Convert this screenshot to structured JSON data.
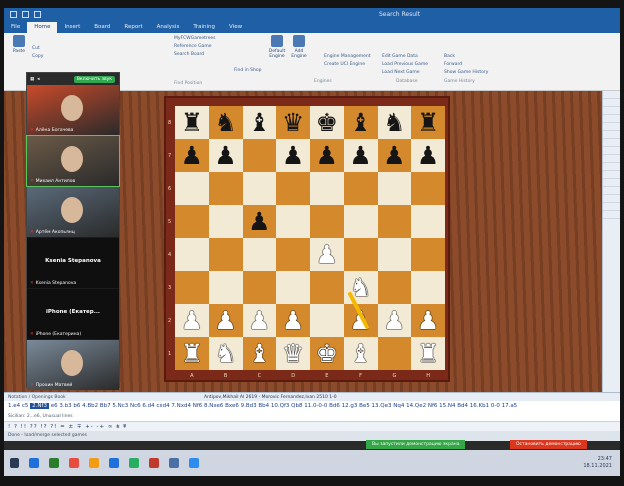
{
  "window": {
    "title": "Search Result"
  },
  "ribbon": {
    "tabs": [
      "File",
      "Home",
      "Insert",
      "Board",
      "Report",
      "Analysis",
      "Training",
      "View"
    ],
    "active_tab": "Home",
    "clipboard": {
      "paste": "Paste",
      "cut": "Cut",
      "copy": "Copy"
    },
    "find": {
      "label": "Find Position",
      "items": [
        "MyFCWGametrees",
        "Reference Game",
        "Search Board"
      ],
      "find_in_shop": "Find in Shop"
    },
    "engines": {
      "label": "Engines",
      "default_engine": "Default Engine",
      "add_engine": "Add Engine",
      "items": [
        "Engine Management",
        "Create UCI Engine"
      ]
    },
    "database": {
      "label": "Database",
      "items": [
        "Edit Game Data",
        "Load Previous Game",
        "Load Next Game"
      ]
    },
    "history": {
      "label": "Game History",
      "items": [
        "Back",
        "Forward",
        "Show Game History"
      ]
    }
  },
  "zoom": {
    "share_button": "Включить звук",
    "participants": [
      {
        "name": "Алёна Богачева",
        "video": true,
        "color": "#c94a2a"
      },
      {
        "name": "Михаил Антипов",
        "video": true,
        "color": "#6a5a48"
      },
      {
        "name": "Артём Акопьянц",
        "video": true,
        "color": "#5a6a7a"
      },
      {
        "name": "Ksenia Stepanova",
        "video": false,
        "color": "#000000"
      },
      {
        "name": "iPhone (Екатерина)",
        "display": "iPhone (Екатер...",
        "video": false,
        "color": "#000000"
      },
      {
        "name": "Прохин Матвей",
        "video": true,
        "color": "#7a8a9a"
      }
    ]
  },
  "board": {
    "rank_labels": [
      "8",
      "7",
      "6",
      "5",
      "4",
      "3",
      "2",
      "1"
    ],
    "file_labels": [
      "A",
      "B",
      "C",
      "D",
      "E",
      "F",
      "G",
      "H"
    ],
    "position": [
      [
        "br",
        "bn",
        "bb",
        "bq",
        "bk",
        "bb",
        "bn",
        "br"
      ],
      [
        "bp",
        "bp",
        "",
        "bp",
        "bp",
        "bp",
        "bp",
        "bp"
      ],
      [
        "",
        "",
        "",
        "",
        "",
        "",
        "",
        ""
      ],
      [
        "",
        "",
        "bp",
        "",
        "",
        "",
        "",
        ""
      ],
      [
        "",
        "",
        "",
        "",
        "wp",
        "",
        "",
        ""
      ],
      [
        "",
        "",
        "",
        "",
        "",
        "wn",
        "",
        ""
      ],
      [
        "wp",
        "wp",
        "wp",
        "wp",
        "",
        "wp",
        "wp",
        "wp"
      ],
      [
        "wr",
        "wn",
        "wb",
        "wq",
        "wk",
        "wb",
        "",
        "wr"
      ]
    ],
    "last_move": "Nf3"
  },
  "game_info": {
    "left": "Notation / Openings Book",
    "players": "Antipov,Mikhail Al 2619 - Morovic Fernandez,Ivan 2510 1-0"
  },
  "notation": {
    "before": "1.e4  c5",
    "current": "2.Nf3",
    "after": "e6  3.b3 b6  4.Bb2 Bb7  5.Nc3 Nc6  6.d4 cxd4  7.Nxd4 Nf6  8.Nxe6 Bxe6  9.Bd3 Bb4  10.Qf3 Qb8  11.0-0-0 Bd6  12.g3 Be5  13.Qe3 Nq4  14.Qe2 Nf6  15.N4 Bd4  16.Kb1 0-0  17.a5",
    "sub": "Sicilian: 2...e6, Unusual lines"
  },
  "annotations": "! ? !! ?? !? ?! = ± ∓ +- -+ ∞ ⩲ ⩱",
  "status": "Done - load/merge selected games",
  "share_bar": {
    "sharing_text": "Вы запустили демонстрацию экрана",
    "stop": "Остановить демонстрацию"
  },
  "taskbar": {
    "icons": [
      "#1e6fd9",
      "#2a7d2a",
      "#e74c3c",
      "#f39c12",
      "#1e6fd9",
      "#27ae60",
      "#c0392b",
      "#4a6fa5",
      "#2d8cf0"
    ],
    "time": "23:47",
    "date": "18.11.2021"
  }
}
